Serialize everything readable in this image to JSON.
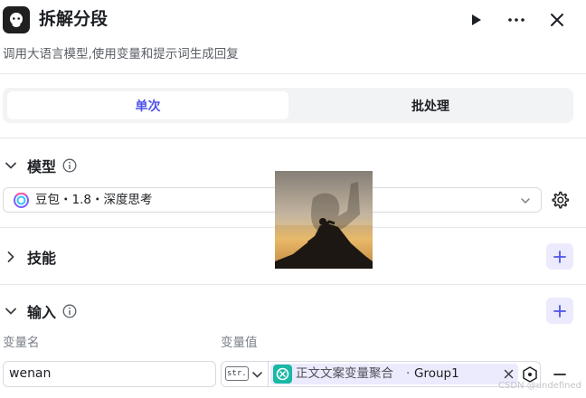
{
  "header": {
    "title": "拆解分段",
    "description": "调用大语言模型,使用变量和提示词生成回复"
  },
  "tabs": [
    {
      "label": "单次",
      "active": true
    },
    {
      "label": "批处理",
      "active": false
    }
  ],
  "model_section": {
    "title": "模型",
    "selected_model": "豆包・1.8・深度思考"
  },
  "skills_section": {
    "title": "技能"
  },
  "input_section": {
    "title": "输入",
    "col_name_label": "变量名",
    "col_value_label": "变量值",
    "row": {
      "name_value": "wenan",
      "type_badge": "str.",
      "ref_source": "正文文案变量聚合",
      "ref_separator": "·",
      "ref_name": "Group1"
    }
  },
  "watermark": "CSDN @undefined",
  "colors": {
    "accent": "#4d53e8",
    "accent_bg": "#eceafd",
    "tag_icon": "#18b8a5",
    "divider": "#e6e7ea"
  },
  "icons": [
    "bot-icon",
    "play-icon",
    "more-icon",
    "close-icon",
    "chevron-down-icon",
    "chevron-right-icon",
    "info-icon",
    "plus-icon",
    "gear-icon",
    "minus-icon",
    "variable-ref-icon"
  ]
}
